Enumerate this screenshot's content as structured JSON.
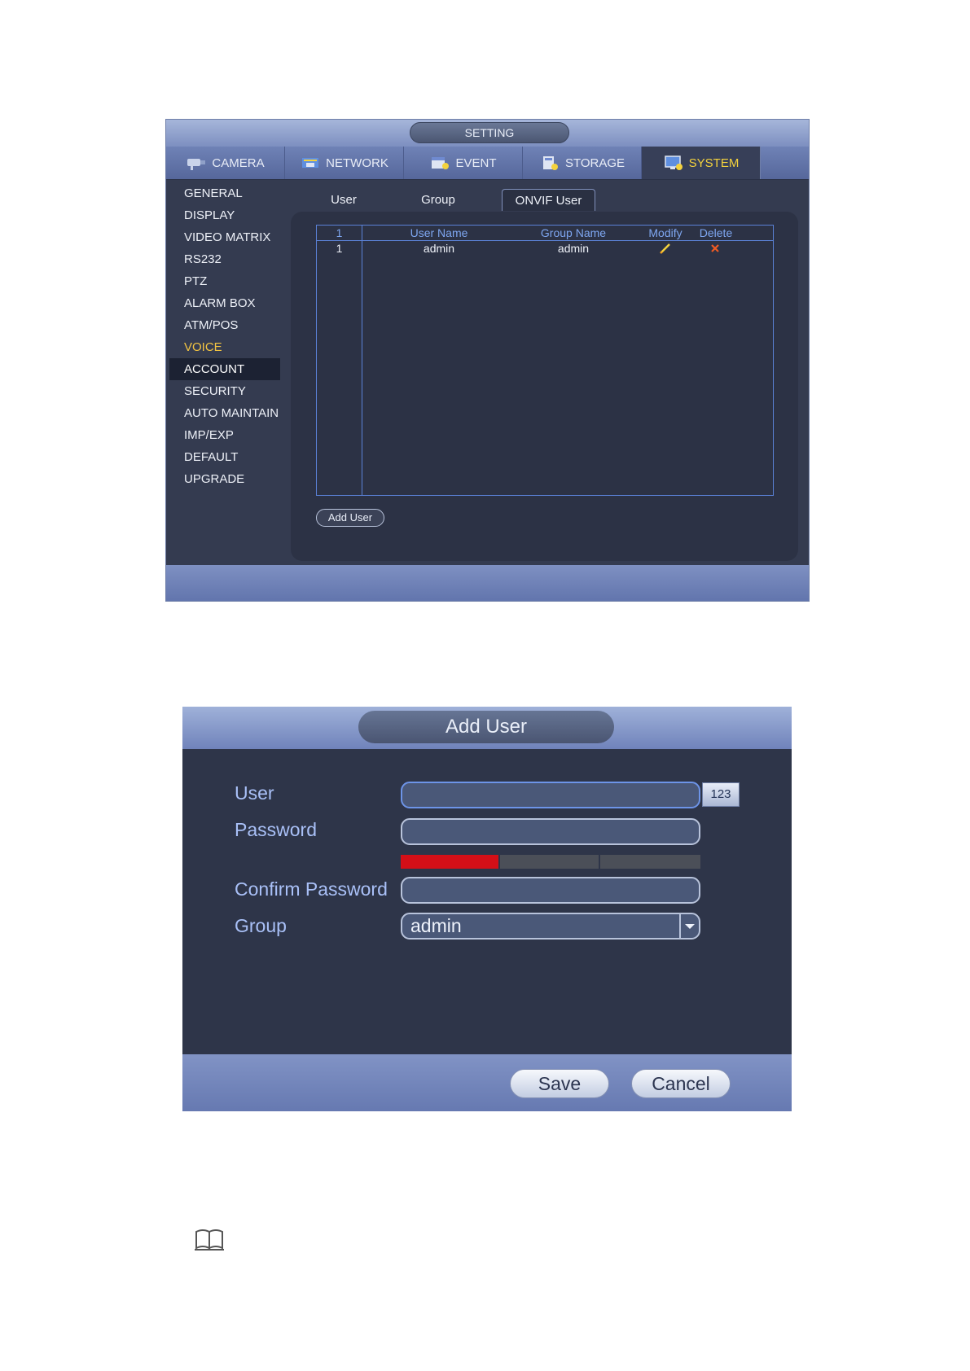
{
  "setting": {
    "title": "SETTING",
    "tabs": [
      {
        "label": "CAMERA",
        "icon": "camera-icon"
      },
      {
        "label": "NETWORK",
        "icon": "network-icon"
      },
      {
        "label": "EVENT",
        "icon": "event-icon"
      },
      {
        "label": "STORAGE",
        "icon": "storage-icon"
      },
      {
        "label": "SYSTEM",
        "icon": "system-icon",
        "active": true
      }
    ],
    "sidebar": [
      "GENERAL",
      "DISPLAY",
      "VIDEO MATRIX",
      "RS232",
      "PTZ",
      "ALARM BOX",
      "ATM/POS",
      "VOICE",
      "ACCOUNT",
      "SECURITY",
      "AUTO MAINTAIN",
      "IMP/EXP",
      "DEFAULT",
      "UPGRADE"
    ],
    "sidebar_highlighted": "VOICE",
    "sidebar_active": "ACCOUNT",
    "subtabs": [
      "User",
      "Group",
      "ONVIF User"
    ],
    "subtab_active": "ONVIF User",
    "table": {
      "headers": [
        "1",
        "User Name",
        "Group Name",
        "Modify",
        "Delete"
      ],
      "rows": [
        {
          "index": "1",
          "user_name": "admin",
          "group_name": "admin",
          "modify_icon": "pencil-icon",
          "delete_icon": "x-icon"
        }
      ]
    },
    "add_user_label": "Add User"
  },
  "dialog": {
    "title": "Add User",
    "user_label": "User",
    "password_label": "Password",
    "confirm_label": "Confirm Password",
    "group_label": "Group",
    "group_value": "admin",
    "keyboard_label": "123",
    "save_label": "Save",
    "cancel_label": "Cancel",
    "strength_segments": 3,
    "strength_level": 1
  },
  "colors": {
    "accent_yellow": "#f4d23d",
    "strength_red": "#d40f17",
    "label_blue": "#a9c0f7",
    "table_header_blue": "#7ea6f0"
  },
  "note_icon": "book-icon"
}
